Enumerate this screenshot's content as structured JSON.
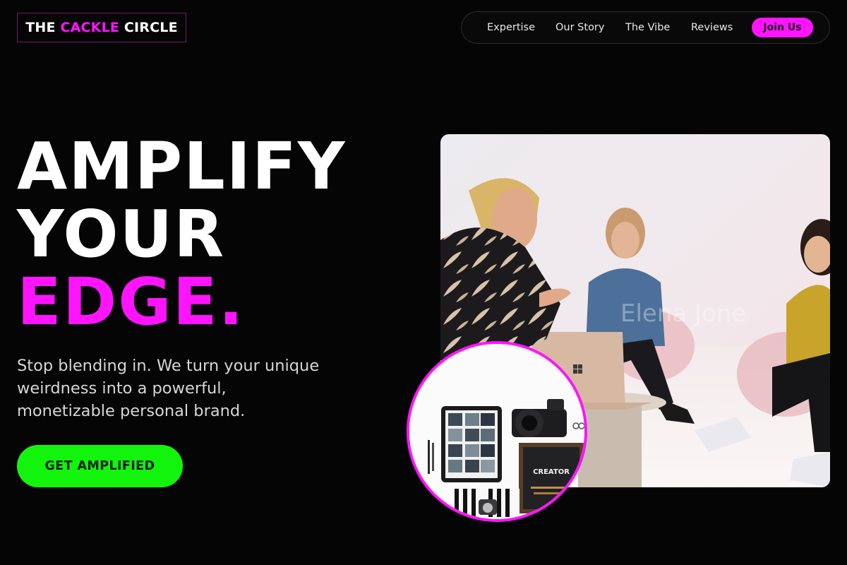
{
  "brand": {
    "prefix": "THE ",
    "accent": "CACKLE",
    "suffix": " CIRCLE",
    "accent_color": "#ff14ff"
  },
  "nav": {
    "items": [
      {
        "label": "Expertise"
      },
      {
        "label": "Our Story"
      },
      {
        "label": "The Vibe"
      },
      {
        "label": "Reviews"
      }
    ],
    "join_label": "Join Us"
  },
  "hero": {
    "line1": "AMPLIFY",
    "line2": "YOUR",
    "line3": "EDGE.",
    "subtitle": "Stop blending in. We turn your unique weirdness into a powerful, monetizable personal brand.",
    "cta_label": "GET AMPLIFIED",
    "cta_color": "#12f40c"
  },
  "images": {
    "team_photo": {
      "icon": "team-meeting-photo",
      "watermark": "Elena Jone"
    },
    "creator_photo": {
      "icon": "creator-flatlay-photo",
      "board_text": "CREATOR"
    }
  }
}
